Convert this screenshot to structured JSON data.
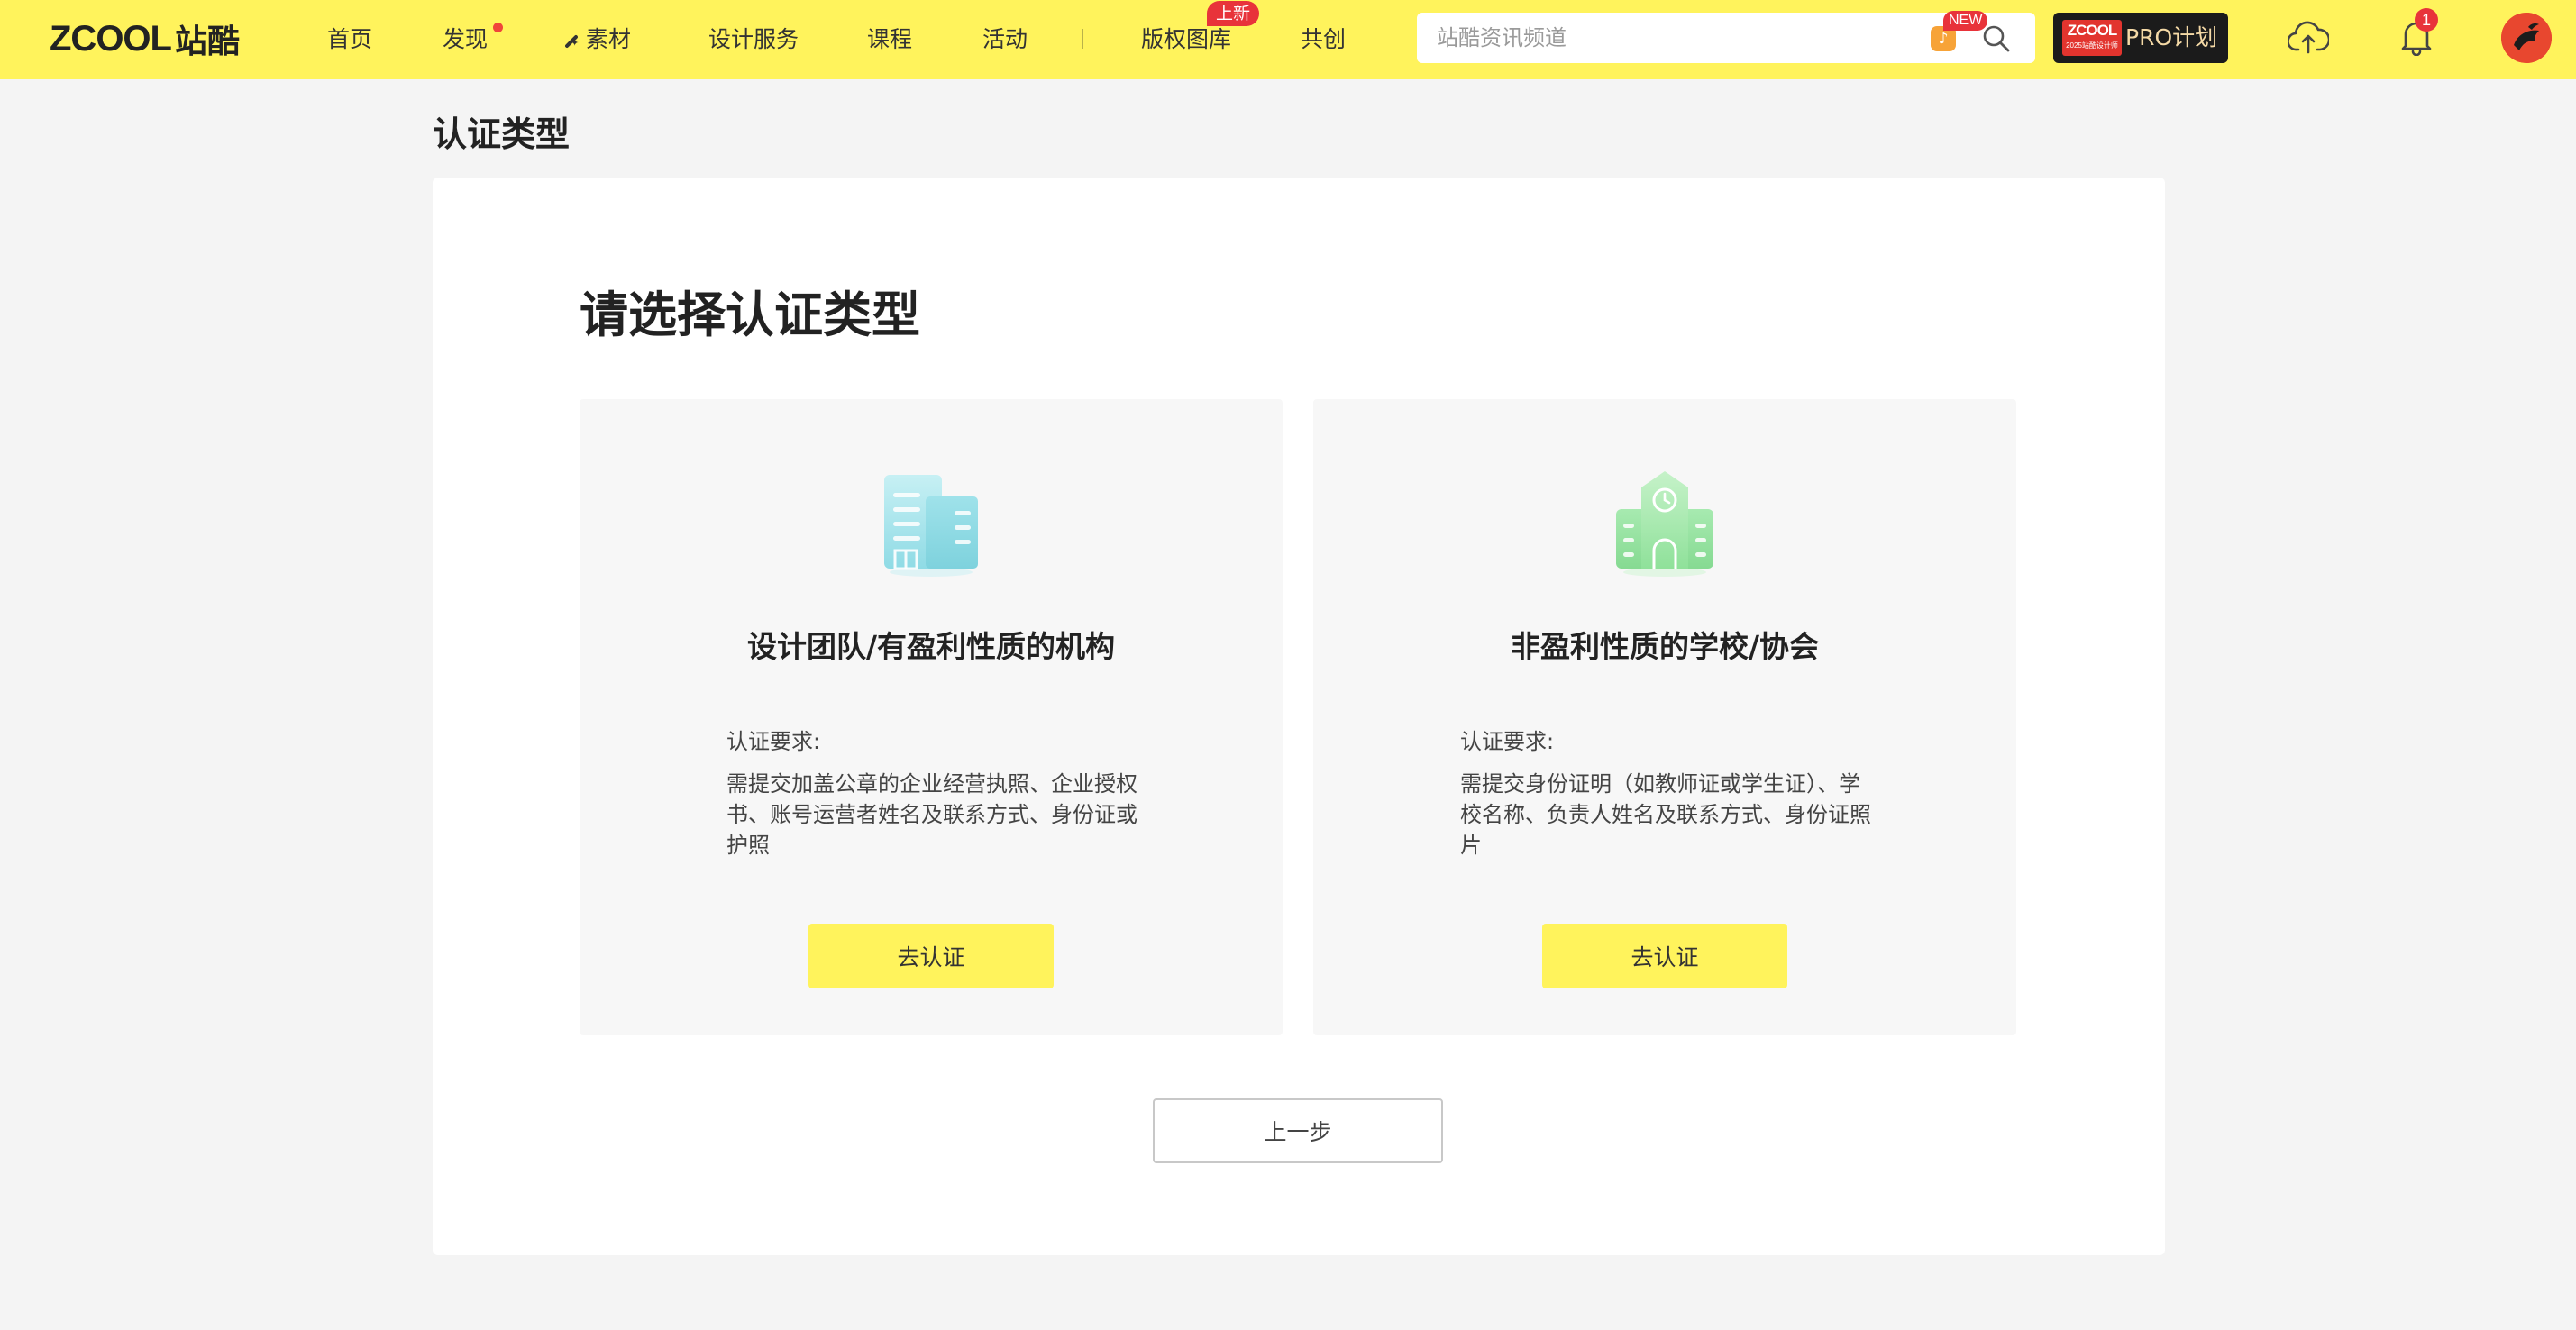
{
  "header": {
    "logo_latin": "ZCOOL",
    "logo_cn": "站酷",
    "nav": [
      {
        "label": "首页"
      },
      {
        "label": "发现"
      },
      {
        "label": "素材"
      },
      {
        "label": "设计服务"
      },
      {
        "label": "课程"
      },
      {
        "label": "活动"
      },
      {
        "label": "版权图库",
        "badge": "上新"
      },
      {
        "label": "共创"
      }
    ],
    "search": {
      "placeholder": "站酷资讯频道",
      "badge": "NEW"
    },
    "pro": {
      "logo": "ZCOOL",
      "logo_sub": "2025站酷设计师",
      "label": "PRO计划"
    },
    "notification_count": "1",
    "icons": {
      "upload": "cloud-upload-icon",
      "bell": "bell-icon",
      "search": "search-icon"
    },
    "colors": {
      "bar": "#fff35c",
      "badge": "#e8333a"
    }
  },
  "page": {
    "title": "认证类型",
    "heading": "请选择认证类型",
    "cards": [
      {
        "title": "设计团队/有盈利性质的机构",
        "req_label": "认证要求:",
        "req_text": "需提交加盖公章的企业经营执照、企业授权书、账号运营者姓名及联系方式、身份证或护照",
        "button": "去认证",
        "icon": "office-building-icon"
      },
      {
        "title": "非盈利性质的学校/协会",
        "req_label": "认证要求:",
        "req_text": "需提交身份证明（如教师证或学生证）、学校名称、负责人姓名及联系方式、身份证照片",
        "button": "去认证",
        "icon": "school-building-icon"
      }
    ],
    "back_button": "上一步"
  }
}
